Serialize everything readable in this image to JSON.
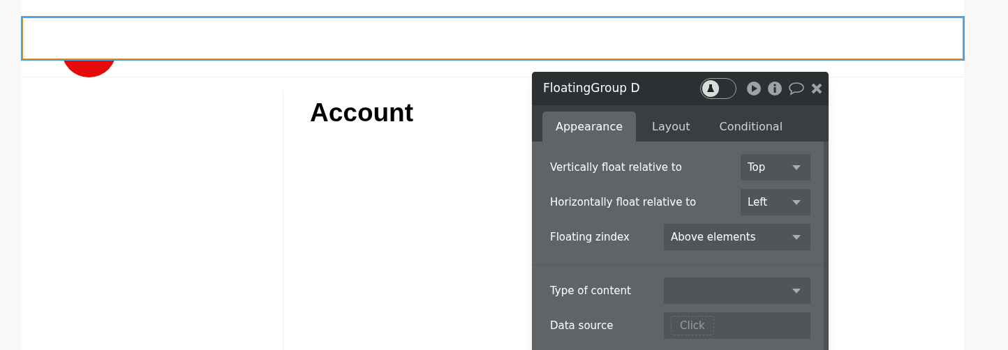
{
  "page": {
    "heading": "Account"
  },
  "panel": {
    "title": "FloatingGroup D",
    "test_toggle": {
      "on": false
    },
    "tabs": [
      {
        "label": "Appearance",
        "selected": true
      },
      {
        "label": "Layout",
        "selected": false
      },
      {
        "label": "Conditional",
        "selected": false
      }
    ],
    "sections": [
      {
        "rows": [
          {
            "kind": "short-dropdown",
            "label": "Vertically float relative to",
            "value": "Top"
          },
          {
            "kind": "short-dropdown",
            "label": "Horizontally float relative to",
            "value": "Left"
          },
          {
            "kind": "dropdown",
            "label": "Floating zindex",
            "value": "Above elements"
          }
        ]
      },
      {
        "rows": [
          {
            "kind": "dropdown",
            "label": "Type of content"
          },
          {
            "kind": "expression",
            "label": "Data source",
            "button": "Click"
          }
        ]
      }
    ]
  }
}
